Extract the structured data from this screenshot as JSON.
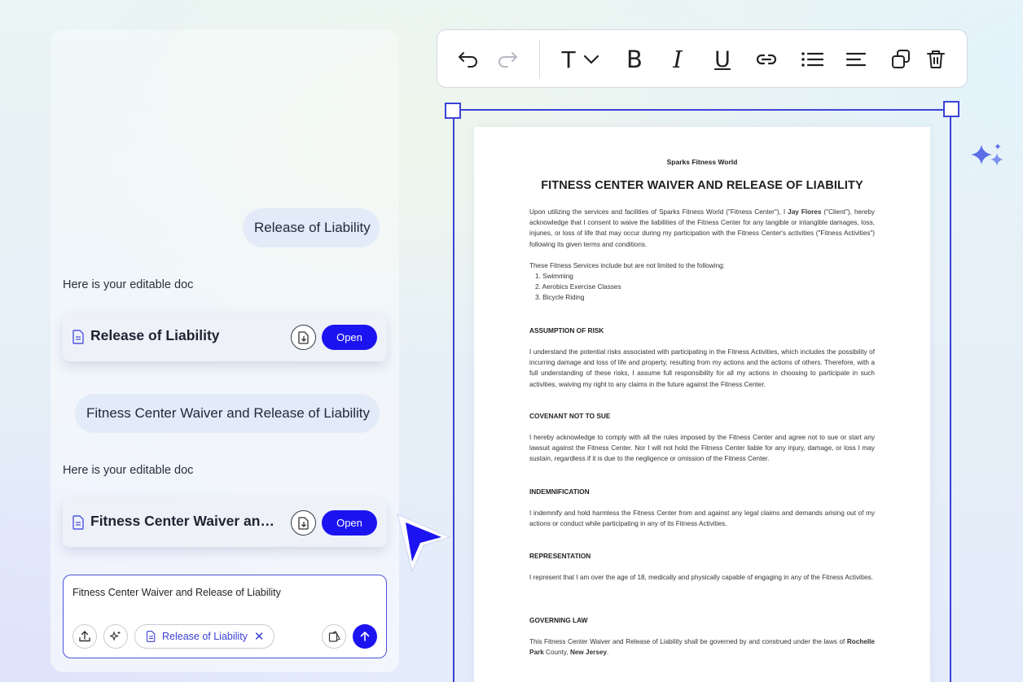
{
  "chat": {
    "messages": [
      {
        "role": "user",
        "text": "Release of Liability"
      },
      {
        "role": "assistant",
        "text": "Here is your editable doc"
      },
      {
        "role": "user",
        "text": "Fitness Center Waiver and Release of Liability"
      },
      {
        "role": "assistant",
        "text": "Here is your editable doc"
      }
    ],
    "cards": [
      {
        "title": "Release of Liability",
        "open_label": "Open"
      },
      {
        "title": "Fitness Center Waiver and Release of Liability",
        "open_label": "Open"
      }
    ],
    "composer": {
      "text": "Fitness Center Waiver and Release of Liability",
      "chip_label": "Release of Liability"
    }
  },
  "toolbar": {
    "icons": [
      "undo-icon",
      "redo-icon",
      "text-style-icon",
      "chevron-down-icon",
      "bold-icon",
      "italic-icon",
      "underline-icon",
      "link-icon",
      "list-icon",
      "align-icon",
      "duplicate-icon",
      "delete-icon"
    ],
    "text_glyph": "T",
    "bold_glyph": "B",
    "italic_glyph": "I",
    "underline_glyph": "U"
  },
  "colors": {
    "accent": "#1c14f0",
    "selection": "#3a43d6"
  },
  "document": {
    "org": "Sparks Fitness World",
    "title": "FITNESS CENTER WAIVER AND RELEASE OF LIABILITY",
    "intro": {
      "pre": "Upon utilizing the services and facilities of Sparks Fitness World (\"Fitness Center\"), I ",
      "name": "Jay Flores",
      "post": " (\"Client\"), hereby acknowledge that I consent to waive the liabilities of the Fitness Center for any tangible or intangible damages, loss, injunes, or loss of life that may occur during my participation with the Fitness Center's activities (\"Fitness Activities\") following its given terms and conditions."
    },
    "services_intro": "These Fitness Services include but are not limited to the following:",
    "services": [
      "1. Swimming",
      "2. Aerobics Exercise Classes",
      "3. Bicycle Riding"
    ],
    "sections": [
      {
        "heading": "ASSUMPTION OF RISK",
        "body": "I understand the potential risks associated with participating in the Fitness Activities, which includes the possibility of incurring damage and loss of life and property, resulting from my actions and the actions of others. Therefore, with a full understanding of these risks, I assume full responsibility for all my actions in choosing to participate in such activities, waiving my right to any claims in the future against the Fitness Center."
      },
      {
        "heading": "COVENANT NOT TO SUE",
        "body": "I hereby acknowledge to comply with all the rules imposed by the Fitness Center and agree not to sue or start any lawsuit against the Fitness Center. Nor I will not hold the Fitness Center liable for any injury, damage, or loss I may sustain, regardless if it is due to the negligence or omission of the Fitness Center."
      },
      {
        "heading": "INDEMNIFICATION",
        "body": "I indemnify and hold harmless the Fitness Center from and against any legal claims and demands arising out of my actions or conduct while participating in any of its Fitness Activities."
      },
      {
        "heading": "REPRESENTATION",
        "body": "I represent that I am over the age of 18, medically and physically capable of engaging in any of the Fitness Activities."
      },
      {
        "heading": "GOVERNING LAW",
        "body_pre": "This Fitness Center Waiver and Release of Liability shall be governed by and construed under the laws of ",
        "county": "Rochelle Park",
        "body_mid": " County, ",
        "state": "New Jersey",
        "body_post": "."
      }
    ]
  }
}
